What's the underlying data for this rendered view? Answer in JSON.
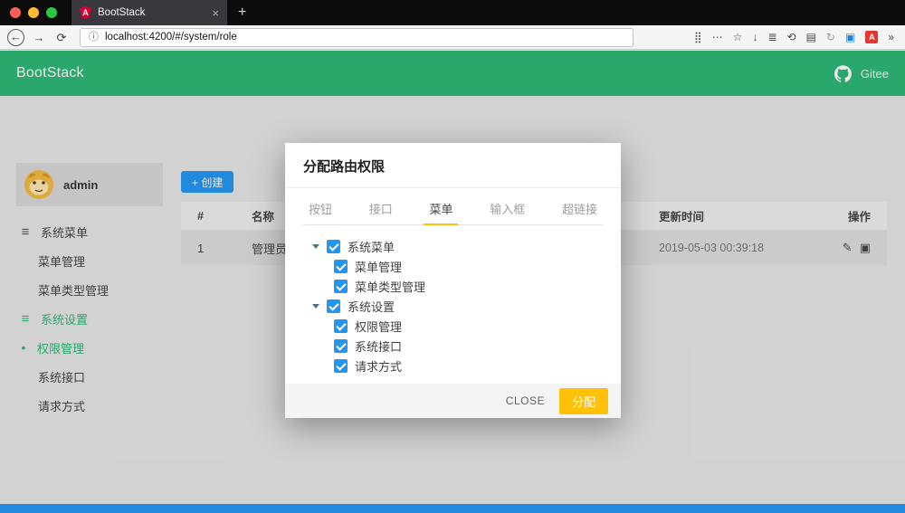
{
  "colors": {
    "green": "#2bb673",
    "blue": "#2196f3",
    "amber": "#ffc107",
    "angular_red": "#dd0031"
  },
  "browser": {
    "tab_title": "BootStack",
    "tab_close": "×",
    "new_tab": "+",
    "back": "←",
    "forward": "→",
    "reload": "⟳",
    "info": "ⓘ",
    "url": "localhost:4200/#/system/role",
    "icons": {
      "angular": "A",
      "grid": "⣿",
      "overflow": "⋯",
      "star": "☆",
      "download": "↓",
      "library": "≣",
      "sync": "⟲",
      "sidebar": "▤",
      "history": "↻",
      "screenshot": "▣",
      "pdf": "A",
      "more": "»"
    }
  },
  "header": {
    "brand": "BootStack",
    "gitee_label": "Gitee"
  },
  "sidebar": {
    "username": "admin",
    "icons": {
      "menu_group": "≡",
      "bullet": "•"
    },
    "menu": [
      {
        "label": "系统菜单"
      },
      {
        "label": "菜单管理"
      },
      {
        "label": "菜单类型管理"
      },
      {
        "label": "系统设置"
      },
      {
        "label": "权限管理"
      },
      {
        "label": "系统接口"
      },
      {
        "label": "请求方式"
      }
    ]
  },
  "main": {
    "create_button": "+ 创建",
    "icons": {
      "edit": "✎",
      "edit_alt": "▣"
    },
    "table": {
      "headers": [
        "#",
        "名称",
        "更新时间",
        "操作"
      ],
      "rows": [
        {
          "index": "1",
          "name": "管理员",
          "updated": "2019-05-03 00:39:18"
        }
      ]
    }
  },
  "modal": {
    "title": "分配路由权限",
    "tabs": [
      "按钮",
      "接口",
      "菜单",
      "输入框",
      "超链接"
    ],
    "active_tab": "菜单",
    "tree": [
      {
        "label": "系统菜单",
        "children": [
          "菜单管理",
          "菜单类型管理"
        ]
      },
      {
        "label": "系统设置",
        "children": [
          "权限管理",
          "系统接口",
          "请求方式"
        ]
      }
    ],
    "close_label": "CLOSE",
    "submit_label": "分配"
  }
}
